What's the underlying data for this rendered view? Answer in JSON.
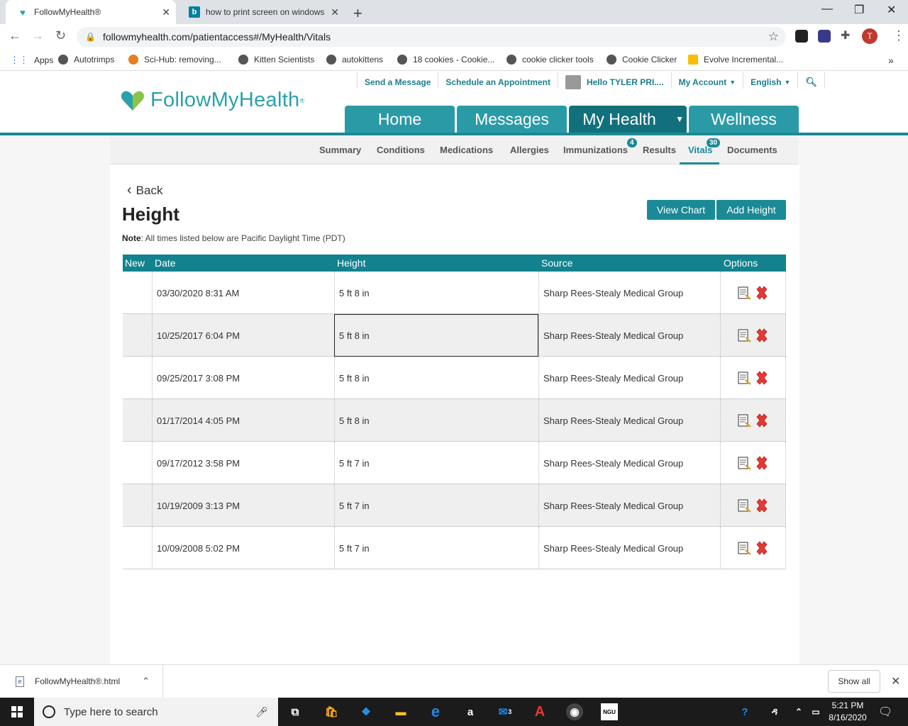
{
  "browser": {
    "tabs": [
      {
        "title": "FollowMyHealth®",
        "active": true
      },
      {
        "title": "how to print screen on windows",
        "active": false
      }
    ],
    "url": "followmyhealth.com/patientaccess#/MyHealth/Vitals",
    "profile_initial": "T",
    "bookmarks": [
      "Apps",
      "Autotrimps",
      "Sci-Hub: removing...",
      "Kitten Scientists",
      "autokittens",
      "18 cookies - Cookie...",
      "cookie clicker tools",
      "Cookie Clicker",
      "Evolve Incremental..."
    ]
  },
  "site": {
    "logo_text": "FollowMyHealth",
    "util_nav": {
      "send_message": "Send a Message",
      "schedule": "Schedule an Appointment",
      "greeting": "Hello TYLER PRI....",
      "account": "My Account",
      "language": "English"
    },
    "main_nav": [
      "Home",
      "Messages",
      "My Health",
      "Wellness"
    ],
    "sub_nav": [
      {
        "label": "Summary"
      },
      {
        "label": "Conditions"
      },
      {
        "label": "Medications"
      },
      {
        "label": "Allergies"
      },
      {
        "label": "Immunizations",
        "badge": "4"
      },
      {
        "label": "Results"
      },
      {
        "label": "Vitals",
        "badge": "30"
      },
      {
        "label": "Documents"
      }
    ]
  },
  "content": {
    "back_label": "Back",
    "title": "Height",
    "note_label": "Note",
    "note_text": ": All times listed below are Pacific Daylight Time (PDT)",
    "view_chart": "View Chart",
    "add_height": "Add Height",
    "columns": {
      "new": "New",
      "date": "Date",
      "height": "Height",
      "source": "Source",
      "options": "Options"
    },
    "rows": [
      {
        "date": "03/30/2020 8:31 AM",
        "height": "5 ft 8 in",
        "source": "Sharp Rees-Stealy Medical Group"
      },
      {
        "date": "10/25/2017 6:04 PM",
        "height": "5 ft 8 in",
        "source": "Sharp Rees-Stealy Medical Group"
      },
      {
        "date": "09/25/2017 3:08 PM",
        "height": "5 ft 8 in",
        "source": "Sharp Rees-Stealy Medical Group"
      },
      {
        "date": "01/17/2014 4:05 PM",
        "height": "5 ft 8 in",
        "source": "Sharp Rees-Stealy Medical Group"
      },
      {
        "date": "09/17/2012 3:58 PM",
        "height": "5 ft 7 in",
        "source": "Sharp Rees-Stealy Medical Group"
      },
      {
        "date": "10/19/2009 3:13 PM",
        "height": "5 ft 7 in",
        "source": "Sharp Rees-Stealy Medical Group"
      },
      {
        "date": "10/09/2008 5:02 PM",
        "height": "5 ft 7 in",
        "source": "Sharp Rees-Stealy Medical Group"
      }
    ]
  },
  "downloads": {
    "file": "FollowMyHealth®.html",
    "show_all": "Show all"
  },
  "taskbar": {
    "search_placeholder": "Type here to search",
    "mail_count": "3",
    "time": "5:21 PM",
    "date": "8/16/2020"
  },
  "colors": {
    "brand_teal": "#1a8a96",
    "active_nav": "#12707c",
    "delete_red": "#e53935"
  }
}
